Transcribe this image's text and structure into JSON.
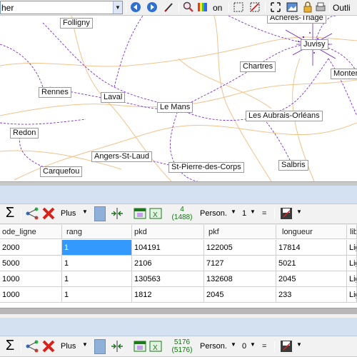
{
  "toolbar": {
    "layer_select_value": "her",
    "on_label": "on",
    "outline_label": "Outli"
  },
  "map": {
    "cities": [
      {
        "name": "Folligny"
      },
      {
        "name": "Achères-Triage"
      },
      {
        "name": "Juvisy"
      },
      {
        "name": "Chartres"
      },
      {
        "name": "Monter"
      },
      {
        "name": "Rennes"
      },
      {
        "name": "Laval"
      },
      {
        "name": "Le Mans"
      },
      {
        "name": "Les Aubrais-Orléans"
      },
      {
        "name": "Redon"
      },
      {
        "name": "Angers-St-Laud"
      },
      {
        "name": "St-Pierre-des-Corps"
      },
      {
        "name": "Salbris"
      },
      {
        "name": "Carquefou"
      }
    ]
  },
  "grid1": {
    "plus_label": "Plus",
    "count_top": "4",
    "count_bottom": "(1488)",
    "person_label": "Person.",
    "num_value": "1",
    "equals": "="
  },
  "grid2": {
    "plus_label": "Plus",
    "count_top": "5176",
    "count_bottom": "(5176)",
    "person_label": "Person.",
    "num_value": "0",
    "equals": "="
  },
  "table": {
    "columns": [
      "ode_ligne",
      "rang",
      "pkd",
      "pkf",
      "longueur",
      "lib"
    ],
    "rows": [
      [
        "2000",
        "1",
        "104191",
        "122005",
        "17814",
        "Lig"
      ],
      [
        "5000",
        "1",
        "2106",
        "7127",
        "5021",
        "Lig"
      ],
      [
        "1000",
        "1",
        "130563",
        "132608",
        "2045",
        "Lig"
      ],
      [
        "1000",
        "1",
        "1812",
        "2045",
        "233",
        "Lig"
      ]
    ]
  },
  "icons": {
    "back": "back-arrow-icon",
    "forward": "forward-arrow-icon",
    "sum": "sigma-icon",
    "close": "red-x-icon",
    "dropdown": "chevron-down-icon"
  }
}
